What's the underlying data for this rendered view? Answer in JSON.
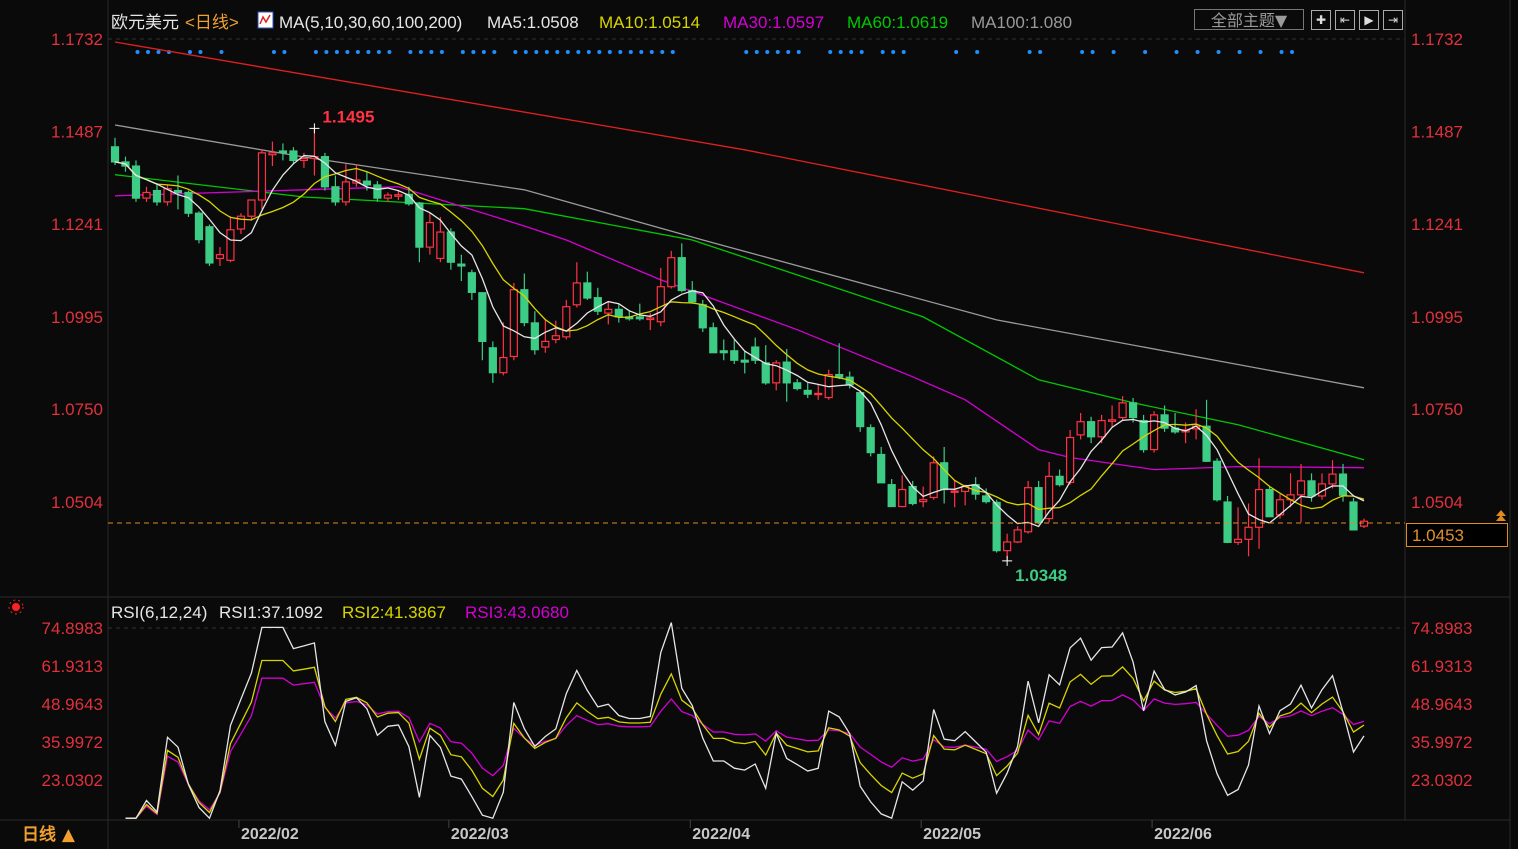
{
  "header": {
    "symbol": "欧元美元",
    "period_tag": "<日线>",
    "indicator": "MA(5,10,30,60,100,200)",
    "ma_values": [
      {
        "label": "MA5:1.0508",
        "color": "#e6e6e6"
      },
      {
        "label": "MA10:1.0514",
        "color": "#d8d400"
      },
      {
        "label": "MA30:1.0597",
        "color": "#d400d4"
      },
      {
        "label": "MA60:1.0619",
        "color": "#00c800"
      },
      {
        "label": "MA100:1.080",
        "color": "#9a9a9a"
      }
    ],
    "theme_button": "全部主题▼",
    "tools": [
      "✚",
      "⇤",
      "▶",
      "⇥"
    ]
  },
  "rsi_header": {
    "indicator": "RSI(6,12,24)",
    "rsi1": "RSI1:37.1092",
    "rsi2": "RSI2:41.3867",
    "rsi3": "RSI3:43.0680"
  },
  "footer": {
    "period_button": "日线 ▲"
  },
  "current_price": "1.0453",
  "colors": {
    "up": "#ff3344",
    "down": "#3dcc85",
    "ma5": "#e6e6e6",
    "ma10": "#d8d400",
    "ma30": "#d400d4",
    "ma60": "#00c800",
    "ma100": "#9a9a9a",
    "ma200": "#e02020",
    "axis": "#e0313c",
    "signal": "#1e90ff",
    "current": "#e08a20"
  },
  "chart_data": [
    {
      "type": "candlestick",
      "title": "欧元美元 日线",
      "ylim": [
        1.0504,
        1.1732
      ],
      "y_ticks": [
        "1.1732",
        "1.1487",
        "1.1241",
        "1.0995",
        "1.0750",
        "1.0504"
      ],
      "x_ticks": [
        {
          "label": "2022/02",
          "index": 12
        },
        {
          "label": "2022/03",
          "index": 32
        },
        {
          "label": "2022/04",
          "index": 55
        },
        {
          "label": "2022/05",
          "index": 77
        },
        {
          "label": "2022/06",
          "index": 99
        }
      ],
      "annotations": {
        "high": "1.1495",
        "low": "1.0348"
      },
      "ohlc": [
        [
          1.1446,
          1.147,
          1.1398,
          1.1406
        ],
        [
          1.1406,
          1.142,
          1.138,
          1.1395
        ],
        [
          1.1395,
          1.141,
          1.13,
          1.131
        ],
        [
          1.131,
          1.134,
          1.13,
          1.1325
        ],
        [
          1.133,
          1.135,
          1.129,
          1.13
        ],
        [
          1.13,
          1.1345,
          1.129,
          1.1335
        ],
        [
          1.133,
          1.137,
          1.128,
          1.1325
        ],
        [
          1.1325,
          1.133,
          1.126,
          1.127
        ],
        [
          1.127,
          1.1275,
          1.119,
          1.12
        ],
        [
          1.1234,
          1.124,
          1.113,
          1.1138
        ],
        [
          1.115,
          1.118,
          1.113,
          1.116
        ],
        [
          1.1145,
          1.1262,
          1.114,
          1.1226
        ],
        [
          1.1228,
          1.127,
          1.1215,
          1.1262
        ],
        [
          1.1262,
          1.13,
          1.125,
          1.1305
        ],
        [
          1.1305,
          1.144,
          1.128,
          1.143
        ],
        [
          1.1425,
          1.146,
          1.1395,
          1.143
        ],
        [
          1.1435,
          1.1455,
          1.141,
          1.143
        ],
        [
          1.1435,
          1.1445,
          1.14,
          1.141
        ],
        [
          1.141,
          1.143,
          1.139,
          1.1415
        ],
        [
          1.1415,
          1.1495,
          1.137,
          1.142
        ],
        [
          1.142,
          1.143,
          1.133,
          1.134
        ],
        [
          1.134,
          1.137,
          1.129,
          1.13
        ],
        [
          1.13,
          1.14,
          1.129,
          1.1353
        ],
        [
          1.135,
          1.14,
          1.134,
          1.1358
        ],
        [
          1.1355,
          1.138,
          1.133,
          1.1345
        ],
        [
          1.1345,
          1.1355,
          1.13,
          1.131
        ],
        [
          1.131,
          1.1325,
          1.13,
          1.1318
        ],
        [
          1.1315,
          1.133,
          1.1305,
          1.1319
        ],
        [
          1.132,
          1.134,
          1.129,
          1.1295
        ],
        [
          1.1297,
          1.13,
          1.114,
          1.118
        ],
        [
          1.118,
          1.127,
          1.116,
          1.1245
        ],
        [
          1.115,
          1.126,
          1.114,
          1.122
        ],
        [
          1.122,
          1.123,
          1.112,
          1.114
        ],
        [
          1.1135,
          1.116,
          1.109,
          1.113
        ],
        [
          1.1112,
          1.112,
          1.104,
          1.106
        ],
        [
          1.1059,
          1.106,
          1.088,
          1.093
        ],
        [
          1.0913,
          1.093,
          1.082,
          1.0847
        ],
        [
          1.0847,
          1.098,
          1.084,
          1.0887
        ],
        [
          1.089,
          1.1085,
          1.088,
          1.1067
        ],
        [
          1.1067,
          1.111,
          1.097,
          1.098
        ],
        [
          1.0979,
          1.101,
          1.0895,
          1.0908
        ],
        [
          1.0915,
          1.099,
          1.09,
          1.093
        ],
        [
          1.0935,
          1.0985,
          1.0925,
          1.0945
        ],
        [
          1.0942,
          1.104,
          1.0935,
          1.1022
        ],
        [
          1.1027,
          1.114,
          1.102,
          1.1085
        ],
        [
          1.1085,
          1.1115,
          1.104,
          1.1045
        ],
        [
          1.1046,
          1.1072,
          1.1,
          1.101
        ],
        [
          1.1005,
          1.1035,
          1.0975,
          1.1015
        ],
        [
          1.1015,
          1.103,
          1.098,
          1.0995
        ],
        [
          1.0995,
          1.101,
          1.0985,
          1.099
        ],
        [
          1.0995,
          1.103,
          1.0985,
          1.099
        ],
        [
          1.0988,
          1.1005,
          1.096,
          1.0992
        ],
        [
          1.0982,
          1.1125,
          1.097,
          1.1075
        ],
        [
          1.1075,
          1.117,
          1.107,
          1.1152
        ],
        [
          1.1152,
          1.119,
          1.106,
          1.1065
        ],
        [
          1.1065,
          1.109,
          1.103,
          1.1035
        ],
        [
          1.1027,
          1.104,
          1.0955,
          1.0966
        ],
        [
          1.0966,
          1.098,
          1.09,
          1.09
        ],
        [
          1.0905,
          1.0935,
          1.088,
          1.09
        ],
        [
          1.0905,
          1.0935,
          1.087,
          1.088
        ],
        [
          1.088,
          1.0905,
          1.0845,
          1.0875
        ],
        [
          1.0915,
          1.094,
          1.087,
          1.088
        ],
        [
          1.0873,
          1.092,
          1.0815,
          1.082
        ],
        [
          1.082,
          1.088,
          1.08,
          1.0873
        ],
        [
          1.0875,
          1.091,
          1.077,
          1.082
        ],
        [
          1.082,
          1.083,
          1.08,
          1.0805
        ],
        [
          1.08,
          1.082,
          1.078,
          1.079
        ],
        [
          1.079,
          1.0815,
          1.0775,
          1.0792
        ],
        [
          1.0781,
          1.0855,
          1.0775,
          1.0842
        ],
        [
          1.0842,
          1.0925,
          1.083,
          1.0835
        ],
        [
          1.0835,
          1.085,
          1.0805,
          1.0815
        ],
        [
          1.0794,
          1.08,
          1.069,
          1.0704
        ],
        [
          1.0701,
          1.071,
          1.0625,
          1.0635
        ],
        [
          1.063,
          1.065,
          1.0555,
          1.0555
        ],
        [
          1.055,
          1.0565,
          1.0495,
          1.0492
        ],
        [
          1.0492,
          1.0575,
          1.049,
          1.0537
        ],
        [
          1.0545,
          1.056,
          1.0495,
          1.05
        ],
        [
          1.0505,
          1.0545,
          1.049,
          1.051
        ],
        [
          1.0516,
          1.0625,
          1.051,
          1.0608
        ],
        [
          1.0608,
          1.065,
          1.05,
          1.0537
        ],
        [
          1.053,
          1.056,
          1.049,
          1.0533
        ],
        [
          1.0532,
          1.055,
          1.0495,
          1.0545
        ],
        [
          1.055,
          1.057,
          1.051,
          1.0525
        ],
        [
          1.052,
          1.054,
          1.05,
          1.0505
        ],
        [
          1.0503,
          1.051,
          1.037,
          1.0375
        ],
        [
          1.0375,
          1.042,
          1.0348,
          1.0398
        ],
        [
          1.0398,
          1.044,
          1.0395,
          1.043
        ],
        [
          1.0425,
          1.056,
          1.042,
          1.0542
        ],
        [
          1.0542,
          1.056,
          1.0445,
          1.045
        ],
        [
          1.046,
          1.061,
          1.045,
          1.0572
        ],
        [
          1.0572,
          1.059,
          1.0545,
          1.055
        ],
        [
          1.0556,
          1.0695,
          1.055,
          1.0675
        ],
        [
          1.0682,
          1.074,
          1.067,
          1.0717
        ],
        [
          1.0717,
          1.073,
          1.066,
          1.0677
        ],
        [
          1.0677,
          1.0735,
          1.066,
          1.072
        ],
        [
          1.0718,
          1.076,
          1.07,
          1.0722
        ],
        [
          1.0728,
          1.0785,
          1.072,
          1.0767
        ],
        [
          1.0767,
          1.078,
          1.0715,
          1.0728
        ],
        [
          1.072,
          1.0735,
          1.0635,
          1.0643
        ],
        [
          1.0643,
          1.0745,
          1.0635,
          1.0735
        ],
        [
          1.0735,
          1.076,
          1.069,
          1.07
        ],
        [
          1.07,
          1.074,
          1.0685,
          1.069
        ],
        [
          1.069,
          1.0715,
          1.066,
          1.0695
        ],
        [
          1.0698,
          1.075,
          1.067,
          1.0705
        ],
        [
          1.0705,
          1.0775,
          1.061,
          1.0612
        ],
        [
          1.0612,
          1.062,
          1.0505,
          1.051
        ],
        [
          1.0504,
          1.052,
          1.0395,
          1.0397
        ],
        [
          1.0397,
          1.049,
          1.039,
          1.0405
        ],
        [
          1.0405,
          1.05,
          1.036,
          1.0437
        ],
        [
          1.0437,
          1.062,
          1.038,
          1.0537
        ],
        [
          1.0537,
          1.0545,
          1.0465,
          1.0465
        ],
        [
          1.047,
          1.0525,
          1.046,
          1.051
        ],
        [
          1.051,
          1.058,
          1.049,
          1.0523
        ],
        [
          1.0523,
          1.0605,
          1.045,
          1.056
        ],
        [
          1.056,
          1.058,
          1.0505,
          1.052
        ],
        [
          1.052,
          1.058,
          1.051,
          1.0552
        ],
        [
          1.0552,
          1.0615,
          1.054,
          1.0578
        ],
        [
          1.0578,
          1.0605,
          1.0505,
          1.0522
        ],
        [
          1.0504,
          1.0515,
          1.044,
          1.043
        ],
        [
          1.044,
          1.046,
          1.0435,
          1.0453
        ]
      ],
      "moving_averages": {
        "ma30": [
          [
            0,
            1.1316
          ],
          [
            18,
            1.1332
          ],
          [
            27,
            1.134
          ],
          [
            39,
            1.1236
          ],
          [
            43,
            1.1199
          ],
          [
            52,
            1.1093
          ],
          [
            65,
            1.0961
          ],
          [
            76,
            1.0836
          ],
          [
            81,
            1.0775
          ],
          [
            88,
            1.0643
          ],
          [
            91,
            1.0622
          ],
          [
            99,
            1.059
          ],
          [
            107,
            1.0598
          ],
          [
            119,
            1.0595
          ]
        ],
        "ma60": [
          [
            0,
            1.1372
          ],
          [
            18,
            1.1313
          ],
          [
            39,
            1.1282
          ],
          [
            55,
            1.1199
          ],
          [
            77,
            1.0995
          ],
          [
            88,
            1.0828
          ],
          [
            97,
            1.0767
          ],
          [
            107,
            1.0709
          ],
          [
            119,
            1.0616
          ]
        ],
        "ma100": [
          [
            0,
            1.1504
          ],
          [
            18,
            1.1419
          ],
          [
            39,
            1.1332
          ],
          [
            56,
            1.1199
          ],
          [
            84,
            1.0987
          ],
          [
            119,
            1.0807
          ]
        ],
        "ma200": [
          [
            0,
            1.1724
          ],
          [
            60,
            1.1438
          ],
          [
            119,
            1.1112
          ]
        ]
      },
      "signal_dots": [
        1,
        2,
        3,
        4,
        6,
        7,
        9,
        14,
        15,
        18,
        19,
        20,
        21,
        22,
        23,
        24,
        25,
        27,
        28,
        29,
        30,
        32,
        33,
        34,
        35,
        37,
        38,
        39,
        40,
        41,
        42,
        43,
        44,
        45,
        46,
        47,
        48,
        49,
        50,
        51,
        52,
        59,
        60,
        61,
        62,
        63,
        64,
        67,
        68,
        69,
        70,
        72,
        73,
        74,
        79,
        81,
        86,
        87,
        91,
        92,
        94,
        97,
        100,
        102,
        104,
        106,
        108,
        110,
        111
      ]
    },
    {
      "type": "line",
      "title": "RSI(6,12,24)",
      "series": [
        {
          "name": "RSI1",
          "period": 6
        },
        {
          "name": "RSI2",
          "period": 12
        },
        {
          "name": "RSI3",
          "period": 24
        }
      ],
      "ylim": [
        23.0302,
        74.8983
      ],
      "y_ticks": [
        "74.8983",
        "61.9313",
        "48.9643",
        "35.9972",
        "23.0302"
      ]
    }
  ]
}
